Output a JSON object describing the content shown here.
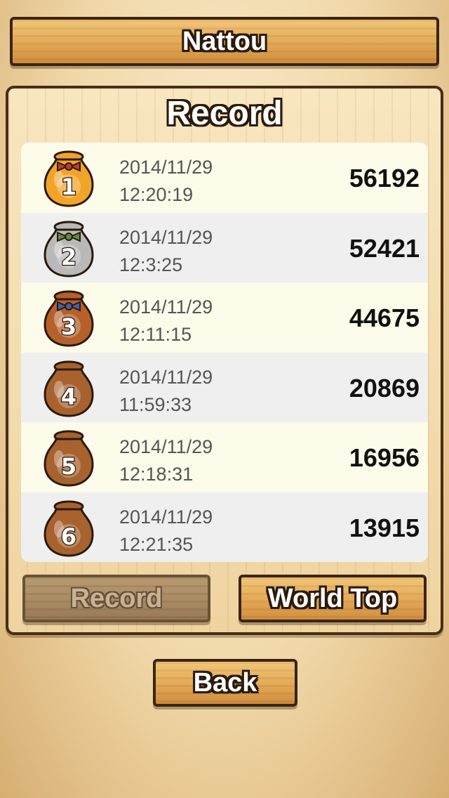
{
  "header": {
    "title": "Nattou"
  },
  "board": {
    "title": "Record"
  },
  "records": [
    {
      "rank": "1",
      "date": "2014/11/29",
      "time": "12:20:19",
      "score": "56192",
      "jar_color": "#f2a428",
      "ribbon_color": "#c0392b"
    },
    {
      "rank": "2",
      "date": "2014/11/29",
      "time": "12:3:25",
      "score": "52421",
      "jar_color": "#b9b9b9",
      "ribbon_color": "#5f8a3a"
    },
    {
      "rank": "3",
      "date": "2014/11/29",
      "time": "12:11:15",
      "score": "44675",
      "jar_color": "#b6602a",
      "ribbon_color": "#3f5fb0"
    },
    {
      "rank": "4",
      "date": "2014/11/29",
      "time": "11:59:33",
      "score": "20869",
      "jar_color": "#a8622e",
      "ribbon_color": ""
    },
    {
      "rank": "5",
      "date": "2014/11/29",
      "time": "12:18:31",
      "score": "16956",
      "jar_color": "#a8622e",
      "ribbon_color": ""
    },
    {
      "rank": "6",
      "date": "2014/11/29",
      "time": "12:21:35",
      "score": "13915",
      "jar_color": "#a8622e",
      "ribbon_color": ""
    }
  ],
  "buttons": {
    "record": "Record",
    "world_top": "World Top",
    "back": "Back"
  }
}
